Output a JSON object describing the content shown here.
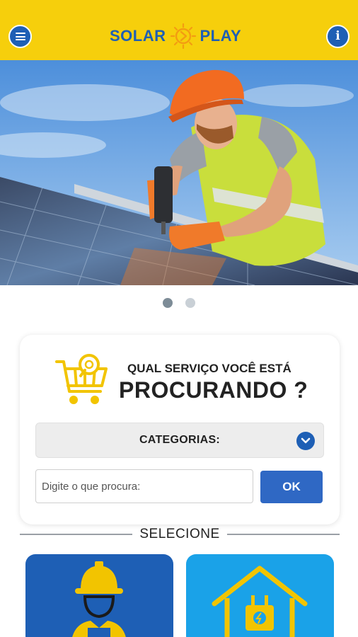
{
  "header": {
    "logo_left": "SOLAR",
    "logo_right": "PLAY",
    "menu_icon": "hamburger-menu-icon",
    "info_icon": "info-icon",
    "info_glyph": "i"
  },
  "carousel": {
    "slide_count": 2,
    "active_index": 0
  },
  "search": {
    "heading_line1": "QUAL SERVIÇO VOCÊ ESTÁ",
    "heading_line2": "PROCURANDO ?",
    "category_label": "CATEGORIAS:",
    "input_placeholder": "Digite o que procura:",
    "input_value": "",
    "ok_label": "OK"
  },
  "section": {
    "title": "SELECIONE"
  },
  "tiles": [
    {
      "icon": "worker-helmet-icon"
    },
    {
      "icon": "house-plug-icon"
    }
  ],
  "colors": {
    "brand_yellow": "#f6cf0c",
    "brand_blue": "#1e5fb5",
    "tile_light_blue": "#1aa2e8",
    "button_blue": "#2f68c4"
  }
}
